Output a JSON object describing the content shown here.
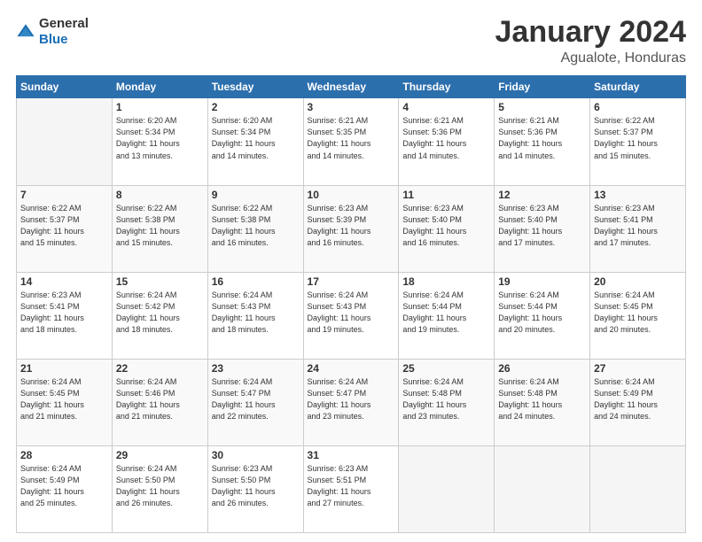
{
  "logo": {
    "general": "General",
    "blue": "Blue"
  },
  "header": {
    "title": "January 2024",
    "location": "Agualote, Honduras"
  },
  "weekdays": [
    "Sunday",
    "Monday",
    "Tuesday",
    "Wednesday",
    "Thursday",
    "Friday",
    "Saturday"
  ],
  "weeks": [
    [
      {
        "day": "",
        "info": ""
      },
      {
        "day": "1",
        "info": "Sunrise: 6:20 AM\nSunset: 5:34 PM\nDaylight: 11 hours\nand 13 minutes."
      },
      {
        "day": "2",
        "info": "Sunrise: 6:20 AM\nSunset: 5:34 PM\nDaylight: 11 hours\nand 14 minutes."
      },
      {
        "day": "3",
        "info": "Sunrise: 6:21 AM\nSunset: 5:35 PM\nDaylight: 11 hours\nand 14 minutes."
      },
      {
        "day": "4",
        "info": "Sunrise: 6:21 AM\nSunset: 5:36 PM\nDaylight: 11 hours\nand 14 minutes."
      },
      {
        "day": "5",
        "info": "Sunrise: 6:21 AM\nSunset: 5:36 PM\nDaylight: 11 hours\nand 14 minutes."
      },
      {
        "day": "6",
        "info": "Sunrise: 6:22 AM\nSunset: 5:37 PM\nDaylight: 11 hours\nand 15 minutes."
      }
    ],
    [
      {
        "day": "7",
        "info": "Sunrise: 6:22 AM\nSunset: 5:37 PM\nDaylight: 11 hours\nand 15 minutes."
      },
      {
        "day": "8",
        "info": "Sunrise: 6:22 AM\nSunset: 5:38 PM\nDaylight: 11 hours\nand 15 minutes."
      },
      {
        "day": "9",
        "info": "Sunrise: 6:22 AM\nSunset: 5:38 PM\nDaylight: 11 hours\nand 16 minutes."
      },
      {
        "day": "10",
        "info": "Sunrise: 6:23 AM\nSunset: 5:39 PM\nDaylight: 11 hours\nand 16 minutes."
      },
      {
        "day": "11",
        "info": "Sunrise: 6:23 AM\nSunset: 5:40 PM\nDaylight: 11 hours\nand 16 minutes."
      },
      {
        "day": "12",
        "info": "Sunrise: 6:23 AM\nSunset: 5:40 PM\nDaylight: 11 hours\nand 17 minutes."
      },
      {
        "day": "13",
        "info": "Sunrise: 6:23 AM\nSunset: 5:41 PM\nDaylight: 11 hours\nand 17 minutes."
      }
    ],
    [
      {
        "day": "14",
        "info": "Sunrise: 6:23 AM\nSunset: 5:41 PM\nDaylight: 11 hours\nand 18 minutes."
      },
      {
        "day": "15",
        "info": "Sunrise: 6:24 AM\nSunset: 5:42 PM\nDaylight: 11 hours\nand 18 minutes."
      },
      {
        "day": "16",
        "info": "Sunrise: 6:24 AM\nSunset: 5:43 PM\nDaylight: 11 hours\nand 18 minutes."
      },
      {
        "day": "17",
        "info": "Sunrise: 6:24 AM\nSunset: 5:43 PM\nDaylight: 11 hours\nand 19 minutes."
      },
      {
        "day": "18",
        "info": "Sunrise: 6:24 AM\nSunset: 5:44 PM\nDaylight: 11 hours\nand 19 minutes."
      },
      {
        "day": "19",
        "info": "Sunrise: 6:24 AM\nSunset: 5:44 PM\nDaylight: 11 hours\nand 20 minutes."
      },
      {
        "day": "20",
        "info": "Sunrise: 6:24 AM\nSunset: 5:45 PM\nDaylight: 11 hours\nand 20 minutes."
      }
    ],
    [
      {
        "day": "21",
        "info": "Sunrise: 6:24 AM\nSunset: 5:45 PM\nDaylight: 11 hours\nand 21 minutes."
      },
      {
        "day": "22",
        "info": "Sunrise: 6:24 AM\nSunset: 5:46 PM\nDaylight: 11 hours\nand 21 minutes."
      },
      {
        "day": "23",
        "info": "Sunrise: 6:24 AM\nSunset: 5:47 PM\nDaylight: 11 hours\nand 22 minutes."
      },
      {
        "day": "24",
        "info": "Sunrise: 6:24 AM\nSunset: 5:47 PM\nDaylight: 11 hours\nand 23 minutes."
      },
      {
        "day": "25",
        "info": "Sunrise: 6:24 AM\nSunset: 5:48 PM\nDaylight: 11 hours\nand 23 minutes."
      },
      {
        "day": "26",
        "info": "Sunrise: 6:24 AM\nSunset: 5:48 PM\nDaylight: 11 hours\nand 24 minutes."
      },
      {
        "day": "27",
        "info": "Sunrise: 6:24 AM\nSunset: 5:49 PM\nDaylight: 11 hours\nand 24 minutes."
      }
    ],
    [
      {
        "day": "28",
        "info": "Sunrise: 6:24 AM\nSunset: 5:49 PM\nDaylight: 11 hours\nand 25 minutes."
      },
      {
        "day": "29",
        "info": "Sunrise: 6:24 AM\nSunset: 5:50 PM\nDaylight: 11 hours\nand 26 minutes."
      },
      {
        "day": "30",
        "info": "Sunrise: 6:23 AM\nSunset: 5:50 PM\nDaylight: 11 hours\nand 26 minutes."
      },
      {
        "day": "31",
        "info": "Sunrise: 6:23 AM\nSunset: 5:51 PM\nDaylight: 11 hours\nand 27 minutes."
      },
      {
        "day": "",
        "info": ""
      },
      {
        "day": "",
        "info": ""
      },
      {
        "day": "",
        "info": ""
      }
    ]
  ]
}
